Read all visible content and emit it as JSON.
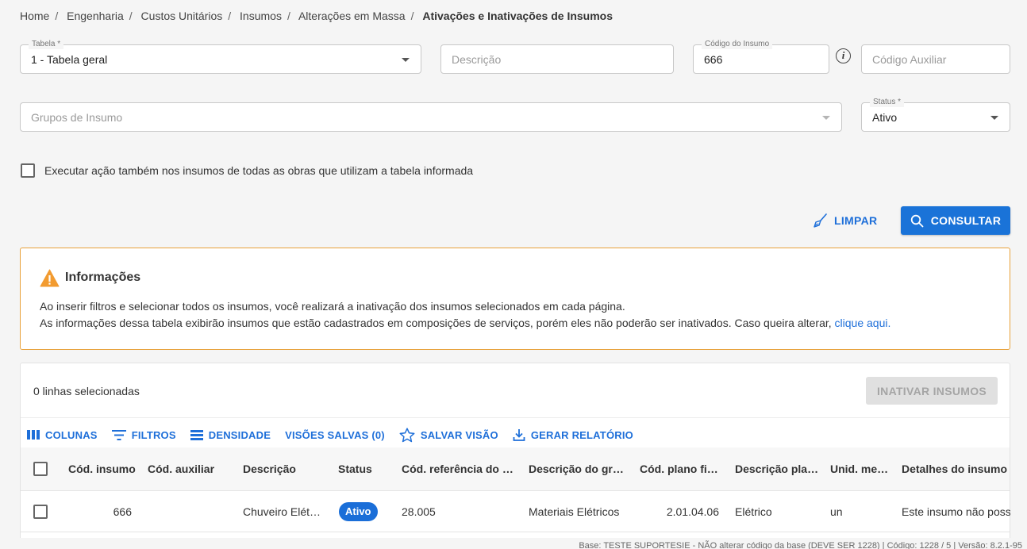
{
  "breadcrumb": {
    "items": [
      "Home",
      "Engenharia",
      "Custos Unitários",
      "Insumos",
      "Alterações em Massa"
    ],
    "current": "Ativações e Inativações de Insumos"
  },
  "filters": {
    "tabela": {
      "label": "Tabela *",
      "value": "1 - Tabela geral"
    },
    "descricao": {
      "placeholder": "Descrição"
    },
    "codigo_insumo": {
      "label": "Código do Insumo",
      "value": "666"
    },
    "codigo_auxiliar": {
      "placeholder": "Código Auxiliar"
    },
    "grupos_insumo": {
      "placeholder": "Grupos de Insumo"
    },
    "status": {
      "label": "Status *",
      "value": "Ativo"
    },
    "checkbox_label": "Executar ação também nos insumos de todas as obras que utilizam a tabela informada"
  },
  "actions": {
    "limpar": "LIMPAR",
    "consultar": "CONSULTAR"
  },
  "alert": {
    "title": "Informações",
    "line1": "Ao inserir filtros e selecionar todos os insumos, você realizará a inativação dos insumos selecionados em cada página.",
    "line2": "As informações dessa tabela exibirão insumos que estão cadastrados em composições de serviços, porém eles não poderão ser inativados. Caso queira alterar,",
    "link": "clique aqui."
  },
  "grid": {
    "selected": "0 linhas selecionadas",
    "inativar": "INATIVAR INSUMOS",
    "toolbar": {
      "colunas": "COLUNAS",
      "filtros": "FILTROS",
      "densidade": "DENSIDADE",
      "visoes": "VISÕES SALVAS (0)",
      "salvar": "SALVAR VISÃO",
      "relatorio": "GERAR RELATÓRIO"
    },
    "columns": [
      "Cód. insumo",
      "Cód. auxiliar",
      "Descrição",
      "Status",
      "Cód. referência do grupo",
      "Descrição do grupo",
      "Cód. plano financeiro",
      "Descrição plano",
      "Unid. medida",
      "Detalhes do insumo"
    ],
    "rows": [
      {
        "cod": "666",
        "aux": "",
        "descricao": "Chuveiro Elétrico",
        "status": "Ativo",
        "ref": "28.005",
        "desc_grupo": "Materiais Elétricos",
        "plano": "2.01.04.06",
        "desc_plano": "Elétrico",
        "unid": "un",
        "detalhes": "Este insumo não possui detalhes"
      }
    ]
  },
  "footer": "Base: TESTE SUPORTESIE - NÃO alterar código da base (DEVE SER 1228) | Código: 1228 / 5 | Versão: 8.2.1-95",
  "colors": {
    "primary": "#1a73d8",
    "warning": "#e8a13a",
    "badge": "#1a6ed8"
  }
}
